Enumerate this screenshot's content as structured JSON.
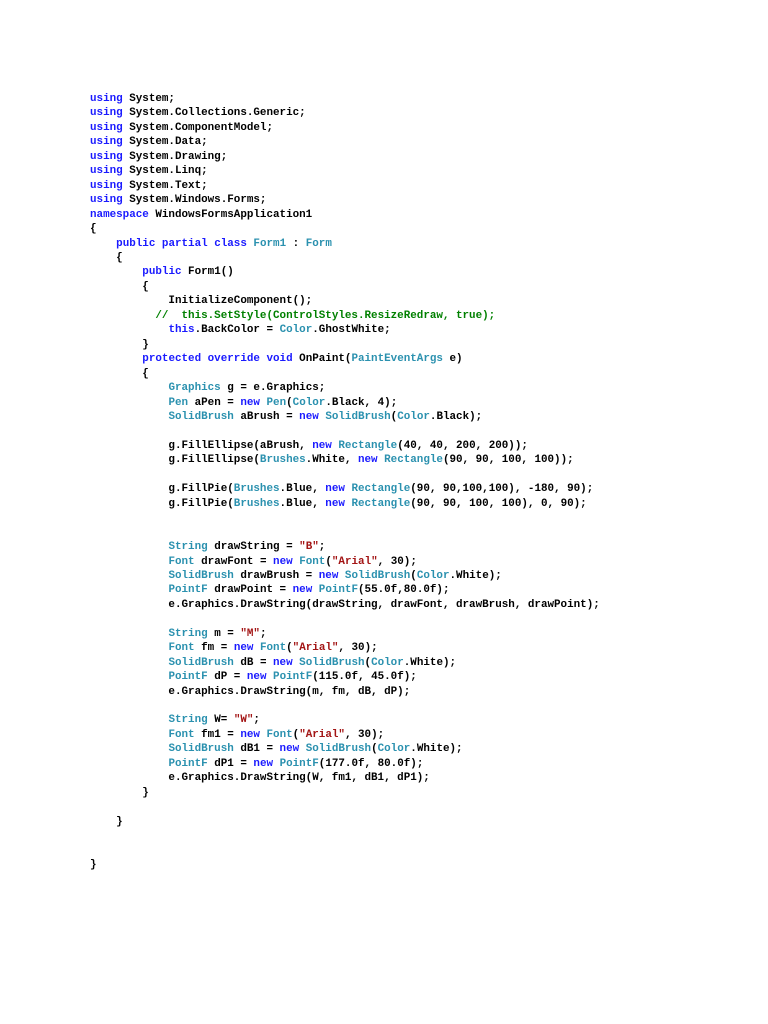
{
  "document": {
    "lines": [
      [
        [
          "using",
          "kw"
        ],
        [
          " System;",
          ""
        ]
      ],
      [
        [
          "using",
          "kw"
        ],
        [
          " System.Collections.Generic;",
          ""
        ]
      ],
      [
        [
          "using",
          "kw"
        ],
        [
          " System.ComponentModel;",
          ""
        ]
      ],
      [
        [
          "using",
          "kw"
        ],
        [
          " System.Data;",
          ""
        ]
      ],
      [
        [
          "using",
          "kw"
        ],
        [
          " System.Drawing;",
          ""
        ]
      ],
      [
        [
          "using",
          "kw"
        ],
        [
          " System.Linq;",
          ""
        ]
      ],
      [
        [
          "using",
          "kw"
        ],
        [
          " System.Text;",
          ""
        ]
      ],
      [
        [
          "using",
          "kw"
        ],
        [
          " System.Windows.Forms;",
          ""
        ]
      ],
      [
        [
          "namespace",
          "kw"
        ],
        [
          " WindowsFormsApplication1",
          ""
        ]
      ],
      [
        [
          "{",
          ""
        ]
      ],
      [
        [
          "    ",
          ""
        ],
        [
          "public partial class",
          "kw"
        ],
        [
          " ",
          ""
        ],
        [
          "Form1",
          "type"
        ],
        [
          " : ",
          ""
        ],
        [
          "Form",
          "type"
        ]
      ],
      [
        [
          "    {",
          ""
        ]
      ],
      [
        [
          "        ",
          ""
        ],
        [
          "public",
          "kw"
        ],
        [
          " Form1()",
          ""
        ]
      ],
      [
        [
          "        {",
          ""
        ]
      ],
      [
        [
          "            InitializeComponent();",
          ""
        ]
      ],
      [
        [
          "          ",
          ""
        ],
        [
          "//  this.SetStyle(ControlStyles.ResizeRedraw, true);",
          "comment"
        ]
      ],
      [
        [
          "            ",
          ""
        ],
        [
          "this",
          "kw"
        ],
        [
          ".BackColor = ",
          ""
        ],
        [
          "Color",
          "type"
        ],
        [
          ".GhostWhite;",
          ""
        ]
      ],
      [
        [
          "        }",
          ""
        ]
      ],
      [
        [
          "        ",
          ""
        ],
        [
          "protected override void",
          "kw"
        ],
        [
          " OnPaint(",
          ""
        ],
        [
          "PaintEventArgs",
          "type"
        ],
        [
          " e)",
          ""
        ]
      ],
      [
        [
          "        {",
          ""
        ]
      ],
      [
        [
          "            ",
          ""
        ],
        [
          "Graphics",
          "type"
        ],
        [
          " g = e.Graphics;",
          ""
        ]
      ],
      [
        [
          "            ",
          ""
        ],
        [
          "Pen",
          "type"
        ],
        [
          " aPen = ",
          ""
        ],
        [
          "new",
          "kw"
        ],
        [
          " ",
          ""
        ],
        [
          "Pen",
          "type"
        ],
        [
          "(",
          ""
        ],
        [
          "Color",
          "type"
        ],
        [
          ".Black, 4);",
          ""
        ]
      ],
      [
        [
          "            ",
          ""
        ],
        [
          "SolidBrush",
          "type"
        ],
        [
          " aBrush = ",
          ""
        ],
        [
          "new",
          "kw"
        ],
        [
          " ",
          ""
        ],
        [
          "SolidBrush",
          "type"
        ],
        [
          "(",
          ""
        ],
        [
          "Color",
          "type"
        ],
        [
          ".Black);",
          ""
        ]
      ],
      [],
      [
        [
          "            g.FillEllipse(aBrush, ",
          ""
        ],
        [
          "new",
          "kw"
        ],
        [
          " ",
          ""
        ],
        [
          "Rectangle",
          "type"
        ],
        [
          "(40, 40, 200, 200));",
          ""
        ]
      ],
      [
        [
          "            g.FillEllipse(",
          ""
        ],
        [
          "Brushes",
          "type"
        ],
        [
          ".White, ",
          ""
        ],
        [
          "new",
          "kw"
        ],
        [
          " ",
          ""
        ],
        [
          "Rectangle",
          "type"
        ],
        [
          "(90, 90, 100, 100));",
          ""
        ]
      ],
      [],
      [
        [
          "            g.FillPie(",
          ""
        ],
        [
          "Brushes",
          "type"
        ],
        [
          ".Blue, ",
          ""
        ],
        [
          "new",
          "kw"
        ],
        [
          " ",
          ""
        ],
        [
          "Rectangle",
          "type"
        ],
        [
          "(90, 90,100,100), -180, 90);",
          ""
        ]
      ],
      [
        [
          "            g.FillPie(",
          ""
        ],
        [
          "Brushes",
          "type"
        ],
        [
          ".Blue, ",
          ""
        ],
        [
          "new",
          "kw"
        ],
        [
          " ",
          ""
        ],
        [
          "Rectangle",
          "type"
        ],
        [
          "(90, 90, 100, 100), 0, 90);",
          ""
        ]
      ],
      [],
      [],
      [
        [
          "            ",
          ""
        ],
        [
          "String",
          "type"
        ],
        [
          " drawString = ",
          ""
        ],
        [
          "\"B\"",
          "str"
        ],
        [
          ";",
          ""
        ]
      ],
      [
        [
          "            ",
          ""
        ],
        [
          "Font",
          "type"
        ],
        [
          " drawFont = ",
          ""
        ],
        [
          "new",
          "kw"
        ],
        [
          " ",
          ""
        ],
        [
          "Font",
          "type"
        ],
        [
          "(",
          ""
        ],
        [
          "\"Arial\"",
          "str"
        ],
        [
          ", 30);",
          ""
        ]
      ],
      [
        [
          "            ",
          ""
        ],
        [
          "SolidBrush",
          "type"
        ],
        [
          " drawBrush = ",
          ""
        ],
        [
          "new",
          "kw"
        ],
        [
          " ",
          ""
        ],
        [
          "SolidBrush",
          "type"
        ],
        [
          "(",
          ""
        ],
        [
          "Color",
          "type"
        ],
        [
          ".White);",
          ""
        ]
      ],
      [
        [
          "            ",
          ""
        ],
        [
          "PointF",
          "type"
        ],
        [
          " drawPoint = ",
          ""
        ],
        [
          "new",
          "kw"
        ],
        [
          " ",
          ""
        ],
        [
          "PointF",
          "type"
        ],
        [
          "(55.0f,80.0f);",
          ""
        ]
      ],
      [
        [
          "            e.Graphics.DrawString(drawString, drawFont, drawBrush, drawPoint);",
          ""
        ]
      ],
      [],
      [
        [
          "            ",
          ""
        ],
        [
          "String",
          "type"
        ],
        [
          " m = ",
          ""
        ],
        [
          "\"M\"",
          "str"
        ],
        [
          ";",
          ""
        ]
      ],
      [
        [
          "            ",
          ""
        ],
        [
          "Font",
          "type"
        ],
        [
          " fm = ",
          ""
        ],
        [
          "new",
          "kw"
        ],
        [
          " ",
          ""
        ],
        [
          "Font",
          "type"
        ],
        [
          "(",
          ""
        ],
        [
          "\"Arial\"",
          "str"
        ],
        [
          ", 30);",
          ""
        ]
      ],
      [
        [
          "            ",
          ""
        ],
        [
          "SolidBrush",
          "type"
        ],
        [
          " dB = ",
          ""
        ],
        [
          "new",
          "kw"
        ],
        [
          " ",
          ""
        ],
        [
          "SolidBrush",
          "type"
        ],
        [
          "(",
          ""
        ],
        [
          "Color",
          "type"
        ],
        [
          ".White);",
          ""
        ]
      ],
      [
        [
          "            ",
          ""
        ],
        [
          "PointF",
          "type"
        ],
        [
          " dP = ",
          ""
        ],
        [
          "new",
          "kw"
        ],
        [
          " ",
          ""
        ],
        [
          "PointF",
          "type"
        ],
        [
          "(115.0f, 45.0f);",
          ""
        ]
      ],
      [
        [
          "            e.Graphics.DrawString(m, fm, dB, dP);",
          ""
        ]
      ],
      [],
      [
        [
          "            ",
          ""
        ],
        [
          "String",
          "type"
        ],
        [
          " W= ",
          ""
        ],
        [
          "\"W\"",
          "str"
        ],
        [
          ";",
          ""
        ]
      ],
      [
        [
          "            ",
          ""
        ],
        [
          "Font",
          "type"
        ],
        [
          " fm1 = ",
          ""
        ],
        [
          "new",
          "kw"
        ],
        [
          " ",
          ""
        ],
        [
          "Font",
          "type"
        ],
        [
          "(",
          ""
        ],
        [
          "\"Arial\"",
          "str"
        ],
        [
          ", 30);",
          ""
        ]
      ],
      [
        [
          "            ",
          ""
        ],
        [
          "SolidBrush",
          "type"
        ],
        [
          " dB1 = ",
          ""
        ],
        [
          "new",
          "kw"
        ],
        [
          " ",
          ""
        ],
        [
          "SolidBrush",
          "type"
        ],
        [
          "(",
          ""
        ],
        [
          "Color",
          "type"
        ],
        [
          ".White);",
          ""
        ]
      ],
      [
        [
          "            ",
          ""
        ],
        [
          "PointF",
          "type"
        ],
        [
          " dP1 = ",
          ""
        ],
        [
          "new",
          "kw"
        ],
        [
          " ",
          ""
        ],
        [
          "PointF",
          "type"
        ],
        [
          "(177.0f, 80.0f);",
          ""
        ]
      ],
      [
        [
          "            e.Graphics.DrawString(W, fm1, dB1, dP1);",
          ""
        ]
      ],
      [
        [
          "        }",
          ""
        ]
      ],
      [],
      [
        [
          "    }",
          ""
        ]
      ],
      [],
      [],
      [
        [
          "}",
          ""
        ]
      ]
    ]
  },
  "colors": {
    "keyword": "#1a1aff",
    "type": "#2b91af",
    "string": "#a31515",
    "comment": "#008000"
  }
}
